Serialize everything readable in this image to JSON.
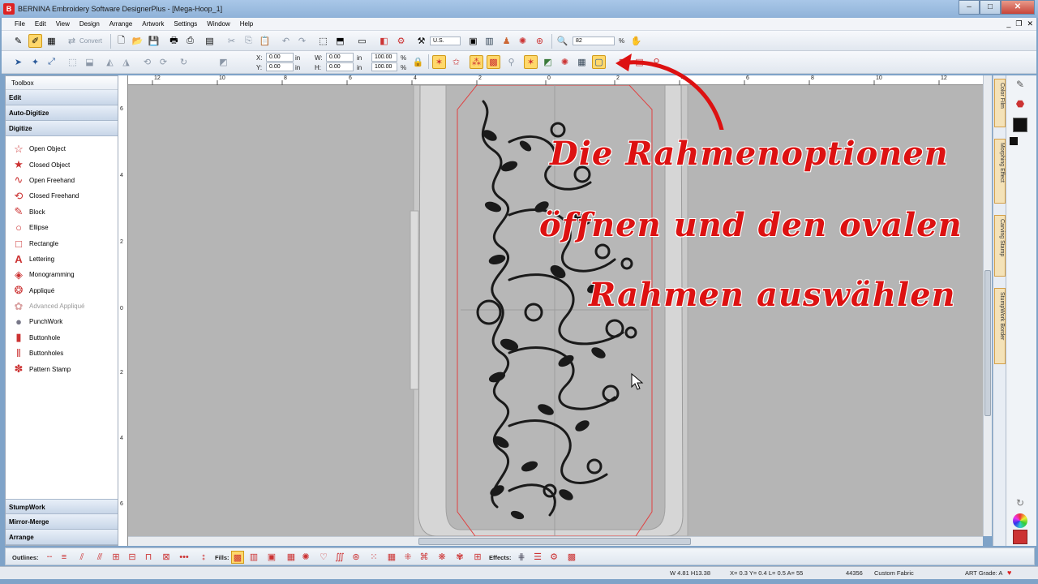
{
  "window": {
    "title": "BERNINA Embroidery Software DesignerPlus - [Mega-Hoop_1]",
    "buttons": [
      "–",
      "□",
      "✕"
    ]
  },
  "menu": [
    "File",
    "Edit",
    "View",
    "Design",
    "Arrange",
    "Artwork",
    "Settings",
    "Window",
    "Help"
  ],
  "toolbar1": {
    "convert_label": "Convert",
    "units": "U.S.",
    "zoom": "82",
    "zoom_unit": "%"
  },
  "toolbar2": {
    "x_label": "X:",
    "x_value": "0.00",
    "x_unit": "in",
    "y_label": "Y:",
    "y_value": "0.00",
    "y_unit": "in",
    "w_label": "W:",
    "w_value": "0.00",
    "w_unit": "in",
    "h_label": "H:",
    "h_value": "0.00",
    "h_unit": "in",
    "sx": "100.00",
    "sy": "100.00",
    "pct": "%"
  },
  "toolbox": {
    "title": "Toolbox",
    "sections_top": [
      "Edit",
      "Auto-Digitize",
      "Digitize"
    ],
    "items": [
      {
        "label": "Open Object",
        "icon": "☆"
      },
      {
        "label": "Closed Object",
        "icon": "★"
      },
      {
        "label": "Open Freehand",
        "icon": "∿"
      },
      {
        "label": "Closed Freehand",
        "icon": "⟲"
      },
      {
        "label": "Block",
        "icon": "✎"
      },
      {
        "label": "Ellipse",
        "icon": "○"
      },
      {
        "label": "Rectangle",
        "icon": "□"
      },
      {
        "label": "Lettering",
        "icon": "A"
      },
      {
        "label": "Monogramming",
        "icon": "◈"
      },
      {
        "label": "Appliqué",
        "icon": "❂"
      },
      {
        "label": "Advanced Appliqué",
        "icon": "✿"
      },
      {
        "label": "PunchWork",
        "icon": "●"
      },
      {
        "label": "Buttonhole",
        "icon": "▮"
      },
      {
        "label": "Buttonholes",
        "icon": "⦀"
      },
      {
        "label": "Pattern Stamp",
        "icon": "✽"
      }
    ],
    "sections_bottom": [
      "StumpWork",
      "Mirror-Merge",
      "Arrange"
    ]
  },
  "ruler_h": [
    "12",
    "10",
    "8",
    "6",
    "4",
    "2",
    "0",
    "2",
    "4",
    "6",
    "8",
    "10",
    "12"
  ],
  "ruler_v": [
    "6",
    "4",
    "2",
    "0",
    "2",
    "4",
    "6"
  ],
  "dockers": [
    "Color Film",
    "Morphing Effect",
    "Carving Stamp",
    "StumpWork Border"
  ],
  "annotation": {
    "line1": "Die Rahmenoptionen",
    "line2": "öffnen und den ovalen",
    "line3": "Rahmen auswählen"
  },
  "bottom_toolbar": {
    "outlines_label": "Outlines:",
    "fills_label": "Fills:",
    "effects_label": "Effects:"
  },
  "status": {
    "size": "W 4.81 H13.38",
    "coords": "X= 0.3 Y= 0.4 L= 0.5 A= 55",
    "stitches": "44356",
    "fabric": "Custom Fabric",
    "grade": "ART Grade: A"
  },
  "colors": {
    "accent": "#dd1111",
    "canvas": "#b5b5b5",
    "hoop_line": "#e04040"
  }
}
